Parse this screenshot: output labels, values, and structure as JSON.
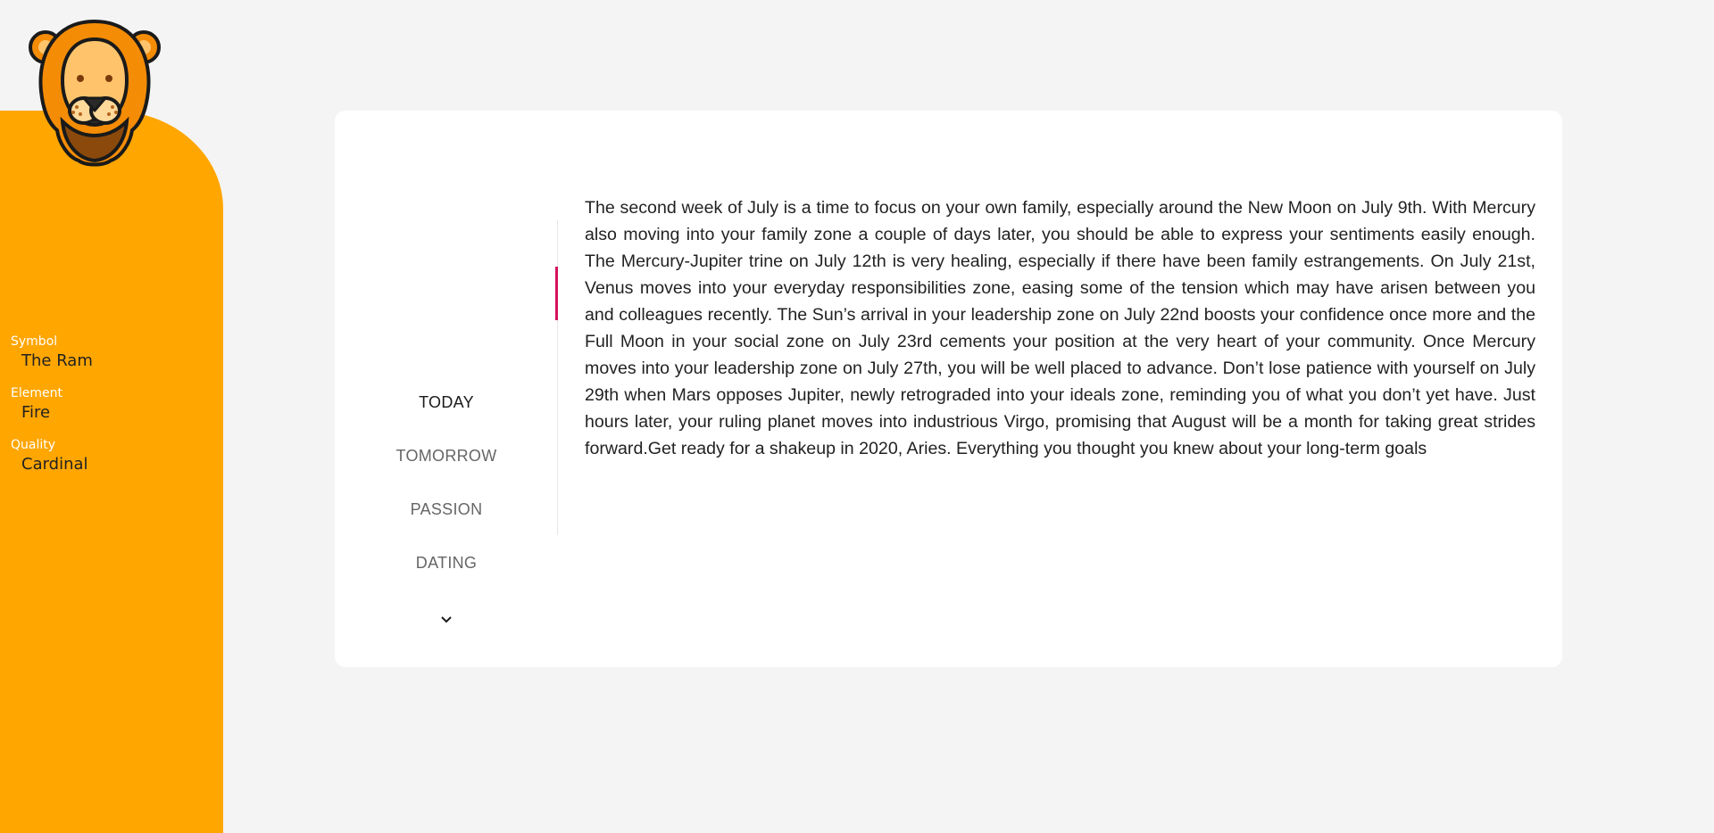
{
  "sidebar": {
    "mascot_icon": "lion-icon",
    "background_color": "#ffa600",
    "attributes": [
      {
        "label": "Symbol",
        "value": "The Ram"
      },
      {
        "label": "Element",
        "value": "Fire"
      },
      {
        "label": "Quality",
        "value": "Cardinal"
      }
    ]
  },
  "tabs": {
    "items": [
      {
        "label": "TODAY",
        "active": true
      },
      {
        "label": "TOMORROW",
        "active": false
      },
      {
        "label": "PASSION",
        "active": false
      },
      {
        "label": "DATING",
        "active": false
      }
    ],
    "more_icon": "chevron-down-icon",
    "active_indicator_color": "#d6115c"
  },
  "horoscope": {
    "text": "The second week of July is a time to focus on your own family, especially around the New Moon on July 9th. With Mercury also moving into your family zone a couple of days later, you should be able to express your sentiments easily enough. The Mercury-Jupiter trine on July 12th is very healing, especially if there have been family estrangements. On July 21st, Venus moves into your everyday responsibilities zone, easing some of the tension which may have arisen between you and colleagues recently. The Sun’s arrival in your leadership zone on July 22nd boosts your confidence once more and the Full Moon in your social zone on July 23rd cements your position at the very heart of your community. Once Mercury moves into your leadership zone on July 27th, you will be well placed to advance. Don’t lose patience with yourself on July 29th when Mars opposes Jupiter, newly retrograded into your ideals zone, reminding you of what you don’t yet have. Just hours later, your ruling planet moves into industrious Virgo, promising that August will be a month for taking great strides forward.Get ready for a shakeup in 2020, Aries. Everything you thought you knew about your long-term goals"
  }
}
